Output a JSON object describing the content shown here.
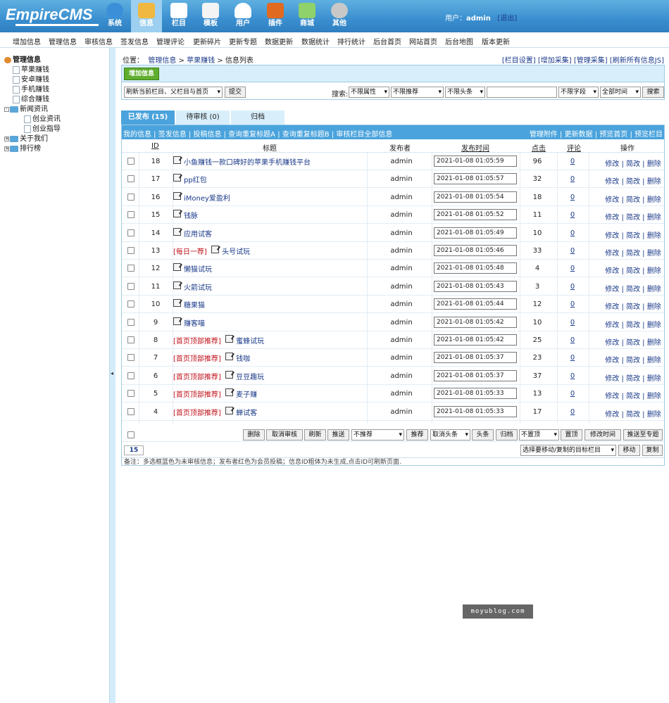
{
  "app": {
    "logo_text": "EmpireCMS"
  },
  "mainnav": [
    {
      "label": "系统",
      "icon": "globe-icon",
      "color": "#3b8fd8"
    },
    {
      "label": "信息",
      "icon": "edit-note-icon",
      "color": "#f0b840"
    },
    {
      "label": "栏目",
      "icon": "folder-icon",
      "color": "#ffffff"
    },
    {
      "label": "模板",
      "icon": "template-window-icon",
      "color": "#f4f4f4"
    },
    {
      "label": "用户",
      "icon": "user-icon",
      "color": "#ffffff"
    },
    {
      "label": "插件",
      "icon": "plugin-tools-icon",
      "color": "#e06a20"
    },
    {
      "label": "商城",
      "icon": "store-icon",
      "color": "#8fd16a"
    },
    {
      "label": "其他",
      "icon": "gear-icon",
      "color": "#c8c8c8"
    }
  ],
  "user": {
    "prefix": "用户：",
    "name": "admin",
    "logout": "[退出]"
  },
  "subnav": [
    "增加信息",
    "管理信息",
    "审核信息",
    "签发信息",
    "管理评论",
    "更新碎片",
    "更新专题",
    "数据更新",
    "数据统计",
    "排行统计",
    "后台首页",
    "网站首页",
    "后台地图",
    "版本更新"
  ],
  "tree": {
    "root": "管理信息",
    "items": [
      "苹果赚钱",
      "安卓赚钱",
      "手机赚钱",
      "综合赚钱"
    ],
    "group": "新闻资讯",
    "group_items": [
      "创业资讯",
      "创业指导"
    ],
    "tail": [
      "关于我们",
      "排行榜"
    ]
  },
  "splitter_arrow": "◂",
  "crumbs": {
    "prefix": "位置：",
    "path1": "管理信息",
    "sep": " > ",
    "path2": "苹果赚钱",
    "path3": "信息列表"
  },
  "toplinks": [
    "[栏目设置]",
    "[增加采集]",
    "[管理采集]",
    "[刷新所有信息JS]"
  ],
  "addbtn": "增加信息",
  "refresh_select": "刷新当前栏目、父栏目与首页",
  "submit_btn": "提交",
  "search": {
    "label": "搜索:",
    "attr": "不限属性",
    "rec": "不限推荐",
    "head": "不限头条",
    "field": "不限字段",
    "time": "全部时间",
    "btn": "搜索",
    "keyword": ""
  },
  "tabs": [
    "已发布 (15)",
    "待审核 (0)",
    "归档"
  ],
  "listlinks_left": "我的信息 | 签发信息 | 投稿信息 | 查询重复标题A | 查询重复标题B | 审核栏目全部信息",
  "listlinks_right": "管理附件 | 更新数据 | 预览首页 | 预览栏目",
  "columns": {
    "id": "ID",
    "title": "标题",
    "author": "发布者",
    "time": "发布时间",
    "hits": "点击",
    "comments": "评论",
    "ops": "操作"
  },
  "ops": "修改 | 简改 | 删除",
  "rows": [
    {
      "id": "18",
      "tag": "",
      "title": "小鱼赚钱一款口碑好的苹果手机赚钱平台",
      "author": "admin",
      "time": "2021-01-08 01:05:59",
      "hits": "96",
      "comments": "0"
    },
    {
      "id": "17",
      "tag": "",
      "title": "pp红包",
      "author": "admin",
      "time": "2021-01-08 01:05:57",
      "hits": "32",
      "comments": "0"
    },
    {
      "id": "16",
      "tag": "",
      "title": "iMoney爱盈利",
      "author": "admin",
      "time": "2021-01-08 01:05:54",
      "hits": "18",
      "comments": "0"
    },
    {
      "id": "15",
      "tag": "",
      "title": "钱脉",
      "author": "admin",
      "time": "2021-01-08 01:05:52",
      "hits": "11",
      "comments": "0"
    },
    {
      "id": "14",
      "tag": "",
      "title": "应用试客",
      "author": "admin",
      "time": "2021-01-08 01:05:49",
      "hits": "10",
      "comments": "0"
    },
    {
      "id": "13",
      "tag": "[每日一荐]",
      "title": "头号试玩",
      "author": "admin",
      "time": "2021-01-08 01:05:46",
      "hits": "33",
      "comments": "0"
    },
    {
      "id": "12",
      "tag": "",
      "title": "懒猫试玩",
      "author": "admin",
      "time": "2021-01-08 01:05:48",
      "hits": "4",
      "comments": "0"
    },
    {
      "id": "11",
      "tag": "",
      "title": "火箭试玩",
      "author": "admin",
      "time": "2021-01-08 01:05:43",
      "hits": "3",
      "comments": "0"
    },
    {
      "id": "10",
      "tag": "",
      "title": "糖果猫",
      "author": "admin",
      "time": "2021-01-08 01:05:44",
      "hits": "12",
      "comments": "0"
    },
    {
      "id": "9",
      "tag": "",
      "title": "赚客喵",
      "author": "admin",
      "time": "2021-01-08 01:05:42",
      "hits": "10",
      "comments": "0"
    },
    {
      "id": "8",
      "tag": "[首页顶部推荐]",
      "title": "蜜蜂试玩",
      "author": "admin",
      "time": "2021-01-08 01:05:42",
      "hits": "25",
      "comments": "0"
    },
    {
      "id": "7",
      "tag": "[首页顶部推荐]",
      "title": "钱咖",
      "author": "admin",
      "time": "2021-01-08 01:05:37",
      "hits": "23",
      "comments": "0"
    },
    {
      "id": "6",
      "tag": "[首页顶部推荐]",
      "title": "豆豆趣玩",
      "author": "admin",
      "time": "2021-01-08 01:05:37",
      "hits": "37",
      "comments": "0"
    },
    {
      "id": "5",
      "tag": "[首页顶部推荐]",
      "title": "麦子赚",
      "author": "admin",
      "time": "2021-01-08 01:05:33",
      "hits": "13",
      "comments": "0"
    },
    {
      "id": "4",
      "tag": "[首页顶部推荐]",
      "title": "蝉试客",
      "author": "admin",
      "time": "2021-01-08 01:05:33",
      "hits": "17",
      "comments": "0"
    }
  ],
  "actions": {
    "delete": "删除",
    "cancel_audit": "取消审核",
    "refresh": "刷新",
    "push": "推送",
    "rec_select": "不推荐",
    "rec_btn": "推荐",
    "head_select": "取消头条",
    "head_btn": "头条",
    "archive": "归档",
    "top_select": "不置顶",
    "top_btn": "置顶",
    "modtime": "修改时间",
    "push_topic": "推送至专题"
  },
  "count": "15",
  "move": {
    "select": "选择要移动/复制的目标栏目",
    "move_btn": "移动",
    "copy_btn": "复制"
  },
  "remark": "备注：多选框蓝色为未审核信息；发布者红色为会员投稿；信息ID粗体为未生成,点击ID可刷新页面.",
  "watermark": "moyublog.com"
}
